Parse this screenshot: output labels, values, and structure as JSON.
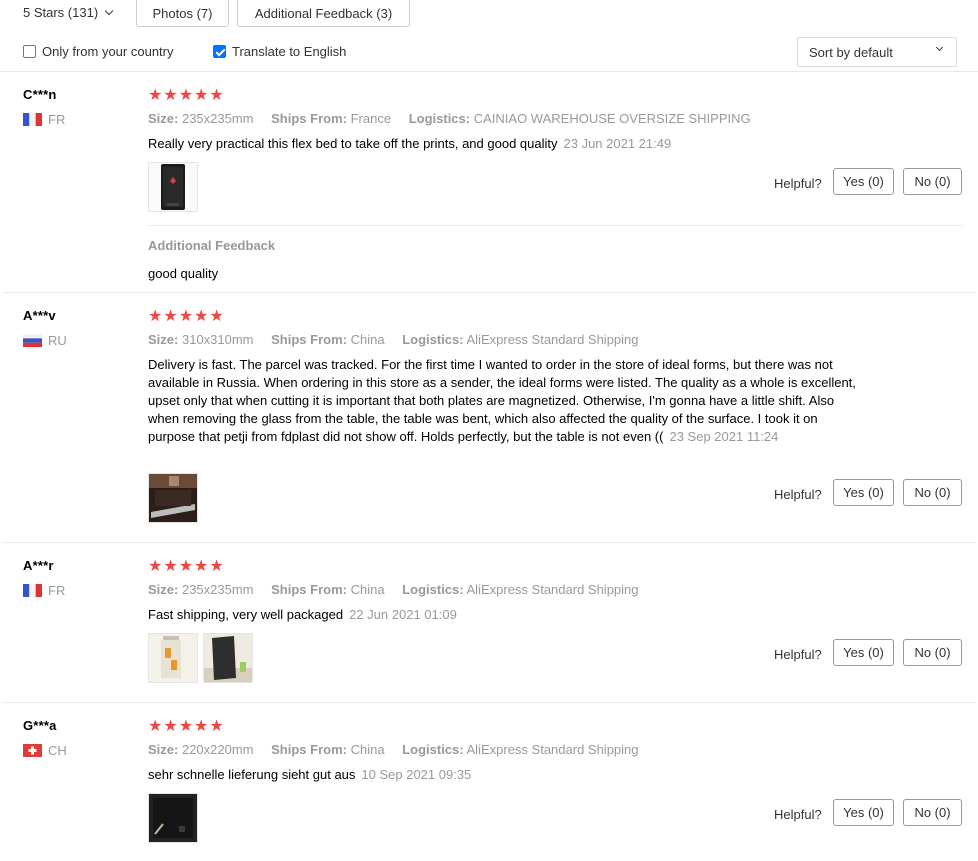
{
  "filters": {
    "star_filter": "5 Stars (131)",
    "photos_button": "Photos (7)",
    "feedback_button": "Additional Feedback (3)",
    "only_country": "Only from your country",
    "only_country_checked": false,
    "translate": "Translate to English",
    "translate_checked": true,
    "sort": "Sort by default"
  },
  "labels": {
    "size": "Size:",
    "ships_from": "Ships From:",
    "logistics": "Logistics:",
    "helpful": "Helpful?",
    "additional_feedback": "Additional Feedback"
  },
  "reviews": [
    {
      "user": "C***n",
      "country": "FR",
      "rating": 5,
      "size": "235x235mm",
      "ships_from": "France",
      "logistics": "CAINIAO WAREHOUSE OVERSIZE SHIPPING",
      "text": "Really very practical this flex bed to take off the prints, and good quality",
      "date": "23 Jun 2021 21:49",
      "yes": "Yes (0)",
      "no": "No (0)",
      "additional_feedback": "good quality"
    },
    {
      "user": "A***v",
      "country": "RU",
      "rating": 5,
      "size": "310x310mm",
      "ships_from": "China",
      "logistics": "AliExpress Standard Shipping",
      "text": "Delivery is fast. The parcel was tracked. For the first time I wanted to order in the store of ideal forms, but there was not available in Russia. When ordering in this store as a sender, the ideal forms were listed. The quality as a whole is excellent, upset only that when cutting it is important that both plates are magnetized. Otherwise, I'm gonna have a little shift. Also when removing the glass from the table, the table was bent, which also affected the quality of the surface. I took it on purpose that petji from fdplast did not show off. Holds perfectly, but the table is not even ((",
      "date": "23 Sep 2021 11:24",
      "yes": "Yes (0)",
      "no": "No (0)"
    },
    {
      "user": "A***r",
      "country": "FR",
      "rating": 5,
      "size": "235x235mm",
      "ships_from": "China",
      "logistics": "AliExpress Standard Shipping",
      "text": "Fast shipping, very well packaged",
      "date": "22 Jun 2021 01:09",
      "yes": "Yes (0)",
      "no": "No (0)"
    },
    {
      "user": "G***a",
      "country": "CH",
      "rating": 5,
      "size": "220x220mm",
      "ships_from": "China",
      "logistics": "AliExpress Standard Shipping",
      "text": "sehr schnelle lieferung sieht gut aus",
      "date": "10 Sep 2021 09:35",
      "yes": "Yes (0)",
      "no": "No (0)"
    }
  ],
  "colors": {
    "star": "#f04645",
    "muted": "#999999",
    "checkbox": "#0075ff"
  }
}
